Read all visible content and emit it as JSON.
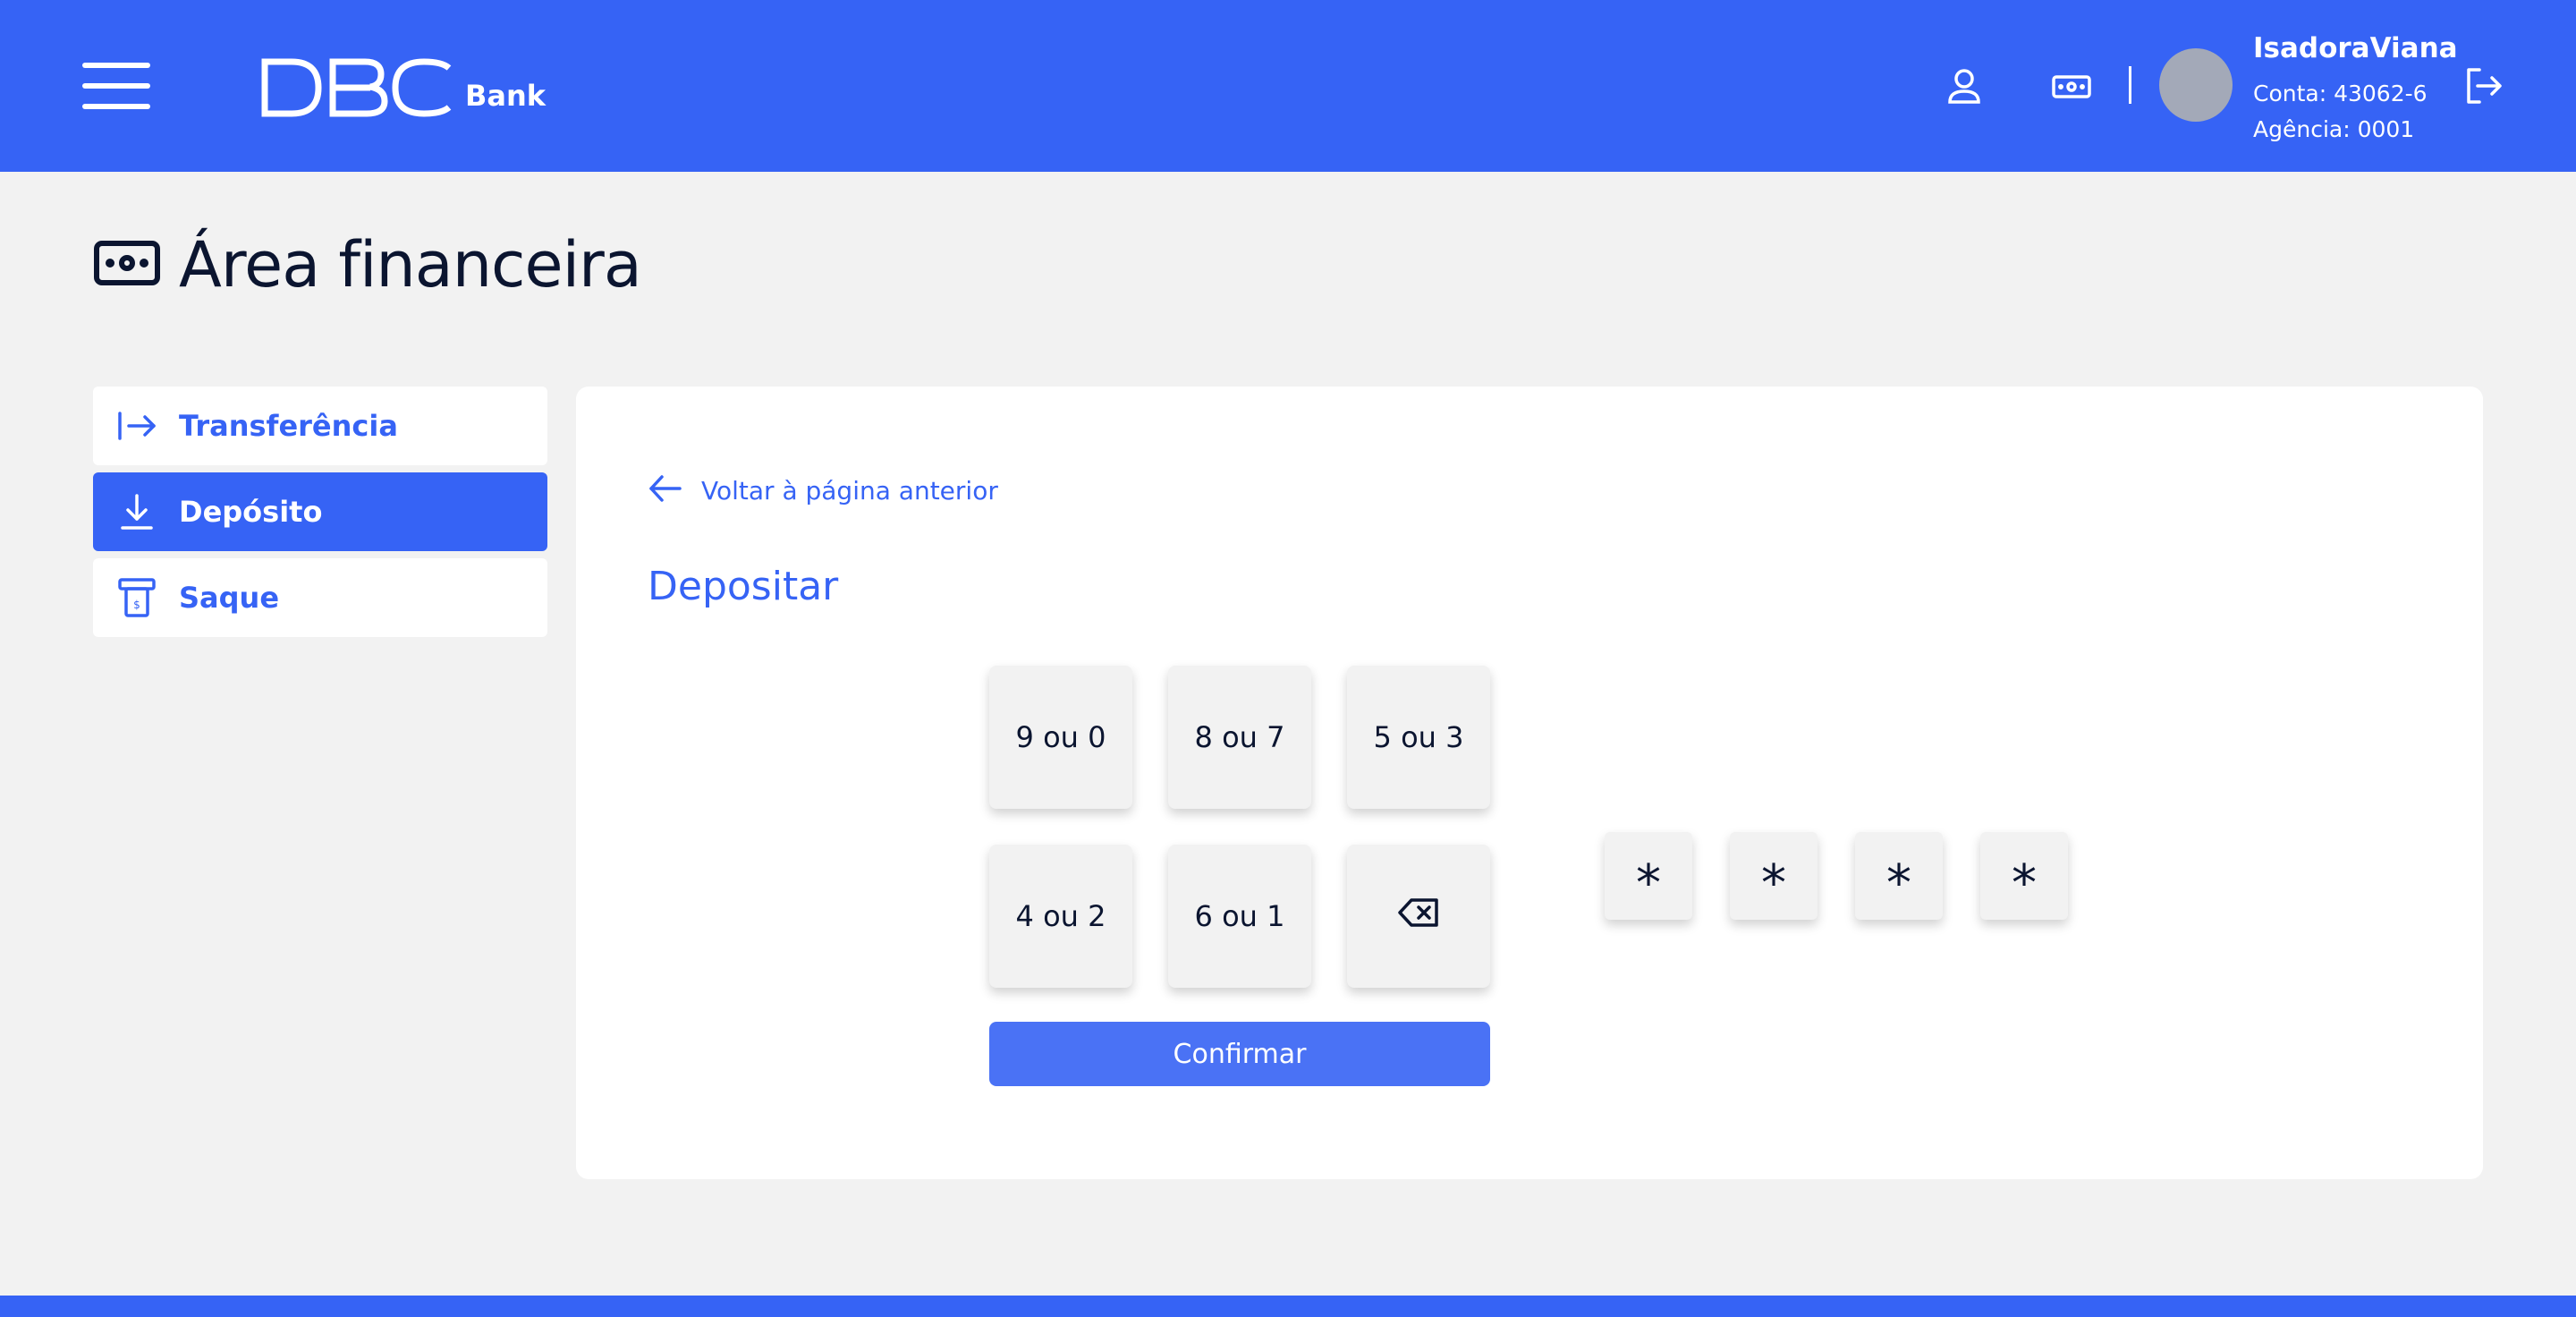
{
  "header": {
    "menu_icon": "hamburger-icon",
    "logo_text": "DBC",
    "logo_subtext": "Bank",
    "profile_icon": "user-icon",
    "finance_icon": "cash-icon",
    "user": {
      "name": "IsadoraViana",
      "account": "Conta: 43062-6",
      "agency": "Agência: 0001"
    },
    "logout_icon": "logout-icon"
  },
  "page": {
    "title": "Área financeira",
    "title_icon": "cash-icon"
  },
  "sidebar": {
    "items": [
      {
        "label": "Transferência",
        "icon": "arrow-right-to-line-icon",
        "active": false
      },
      {
        "label": "Depósito",
        "icon": "download-icon",
        "active": true
      },
      {
        "label": "Saque",
        "icon": "atm-withdraw-icon",
        "active": false
      }
    ]
  },
  "main": {
    "back_label": "Voltar à página anterior",
    "section_title": "Depositar",
    "keypad": {
      "keys": [
        "9 ou 0",
        "8 ou 7",
        "5 ou 3",
        "4 ou 2",
        "6 ou 1"
      ],
      "backspace_icon": "backspace-icon"
    },
    "confirm_label": "Confirmar",
    "pin_display": [
      "*",
      "*",
      "*",
      "*"
    ]
  },
  "colors": {
    "primary": "#3663f5",
    "background": "#f2f2f2",
    "text_dark": "#0b1530",
    "avatar": "#a3a9b8"
  }
}
